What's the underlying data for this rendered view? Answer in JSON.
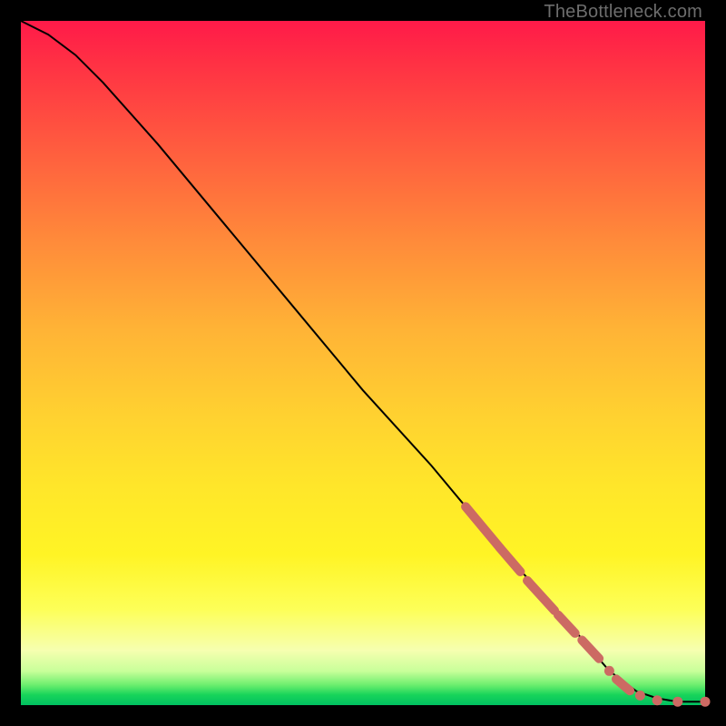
{
  "watermark": "TheBottleneck.com",
  "colors": {
    "background": "#000000",
    "curve": "#000000",
    "marker": "#cc6a63"
  },
  "chart_data": {
    "type": "line",
    "title": "",
    "xlabel": "",
    "ylabel": "",
    "xlim": [
      0,
      100
    ],
    "ylim": [
      0,
      100
    ],
    "series": [
      {
        "name": "curve",
        "x": [
          0,
          4,
          8,
          12,
          20,
          30,
          40,
          50,
          60,
          70,
          80,
          86,
          90,
          93,
          96,
          100
        ],
        "y": [
          100,
          98,
          95,
          91,
          82,
          70,
          58,
          46,
          35,
          23,
          12,
          5,
          2,
          1,
          0.5,
          0.5
        ]
      }
    ],
    "markers": [
      {
        "type": "segment",
        "x0": 65,
        "y0": 29,
        "x1": 70,
        "y1": 23
      },
      {
        "type": "segment",
        "x0": 70,
        "y0": 23,
        "x1": 73,
        "y1": 19.5
      },
      {
        "type": "segment",
        "x0": 74,
        "y0": 18.2,
        "x1": 78,
        "y1": 13.8
      },
      {
        "type": "segment",
        "x0": 78.5,
        "y0": 13.2,
        "x1": 81,
        "y1": 10.5
      },
      {
        "type": "segment",
        "x0": 82,
        "y0": 9.5,
        "x1": 84.5,
        "y1": 6.8
      },
      {
        "type": "dot",
        "x": 86,
        "y": 5
      },
      {
        "type": "segment",
        "x0": 87,
        "y0": 3.8,
        "x1": 89,
        "y1": 2.1
      },
      {
        "type": "dot",
        "x": 90.5,
        "y": 1.4
      },
      {
        "type": "dot",
        "x": 93,
        "y": 0.7
      },
      {
        "type": "dot",
        "x": 96,
        "y": 0.5
      },
      {
        "type": "dot",
        "x": 100,
        "y": 0.5
      }
    ]
  }
}
